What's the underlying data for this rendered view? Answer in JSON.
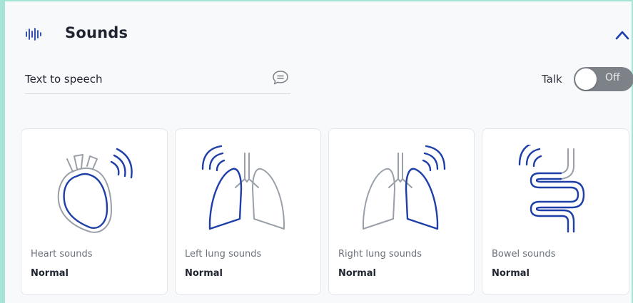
{
  "header": {
    "title": "Sounds",
    "icon": "sound-wave-icon",
    "collapse_icon": "chevron-up-icon"
  },
  "tts": {
    "label": "Text to speech",
    "icon": "chat-bubble-icon"
  },
  "talk": {
    "label": "Talk",
    "toggle_state": "Off"
  },
  "cards": [
    {
      "label": "Heart sounds",
      "status": "Normal",
      "icon": "heart-icon"
    },
    {
      "label": "Left lung sounds",
      "status": "Normal",
      "icon": "left-lung-icon"
    },
    {
      "label": "Right lung sounds",
      "status": "Normal",
      "icon": "right-lung-icon"
    },
    {
      "label": "Bowel sounds",
      "status": "Normal",
      "icon": "bowel-icon"
    }
  ],
  "colors": {
    "accent": "#1e3fa8",
    "outline": "#9aa0a8",
    "frame": "#a6e4d6",
    "toggle_off": "#7d8188"
  }
}
